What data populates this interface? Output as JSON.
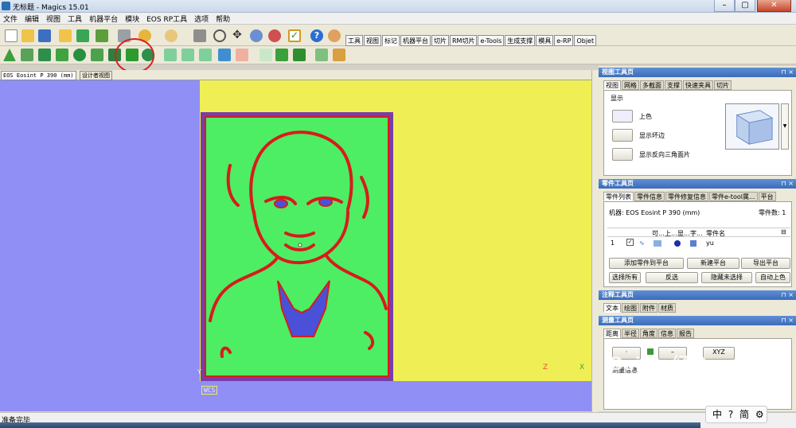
{
  "window": {
    "title": "无标题 - Magics 15.01",
    "minimize_label": "–",
    "maximize_label": "▢",
    "close_label": "✕"
  },
  "menu": [
    "文件",
    "编辑",
    "视图",
    "工具",
    "机器平台",
    "模块",
    "EOS RP工具",
    "选项",
    "帮助"
  ],
  "ribbon_tabs": [
    "工具",
    "视图",
    "标记",
    "机器平台",
    "切片",
    "RM切片",
    "e-Tools",
    "生成支撑",
    "模具",
    "e-RP",
    "Objet"
  ],
  "ribbon_active_tab": "标记",
  "doc_tabs": [
    "EOS Eosint P 390 (mm)",
    "设计者视图"
  ],
  "viewport": {
    "wcs_label": "WCS",
    "axis_z": "Z",
    "axis_x": "X",
    "axis_y": "Y",
    "colors": {
      "background": "#8f8ff5",
      "platform": "#efef55",
      "part": "#4ded64",
      "contour": "#d81b1b",
      "inner": "#4b50d8"
    }
  },
  "view_panel": {
    "title": "视图工具页",
    "tabs": [
      "视图",
      "网格",
      "多截面",
      "支撑",
      "快速夹具",
      "切片"
    ],
    "group_label": "显示",
    "buttons": [
      "上色",
      "显示坏边",
      "显示反向三角面片"
    ]
  },
  "parts_panel": {
    "title": "零件工具页",
    "tabs": [
      "零件列表",
      "零件信息",
      "零件修复信息",
      "零件e-tool属...",
      "平台"
    ],
    "machine_label": "机器: EOS Eosint P 390 (mm)",
    "count_label": "零件数: 1",
    "columns": [
      "",
      "",
      "可...",
      "上...",
      "显...",
      "字...",
      "零件名"
    ],
    "rows": [
      {
        "index": "1",
        "name": "yu"
      }
    ],
    "buttons": [
      "添加零件到平台",
      "新建平台",
      "导出平台",
      "选择所有",
      "反选",
      "隐藏未选择",
      "自动上色"
    ]
  },
  "annotation_panel": {
    "title": "注释工具页",
    "tabs": [
      "文本",
      "绘图",
      "附件",
      "材质"
    ]
  },
  "measure_panel": {
    "title": "测量工具页",
    "tabs": [
      "距离",
      "半径",
      "角度",
      "信息",
      "报告"
    ],
    "xyz_label": "XYZ",
    "info_label": "测量信息"
  },
  "status_text": "准备完毕",
  "ime_text": "中 ? 简 ⚙",
  "watermark": {
    "brand": "Baidu 经验",
    "url": "jingyan.baidu.com"
  }
}
